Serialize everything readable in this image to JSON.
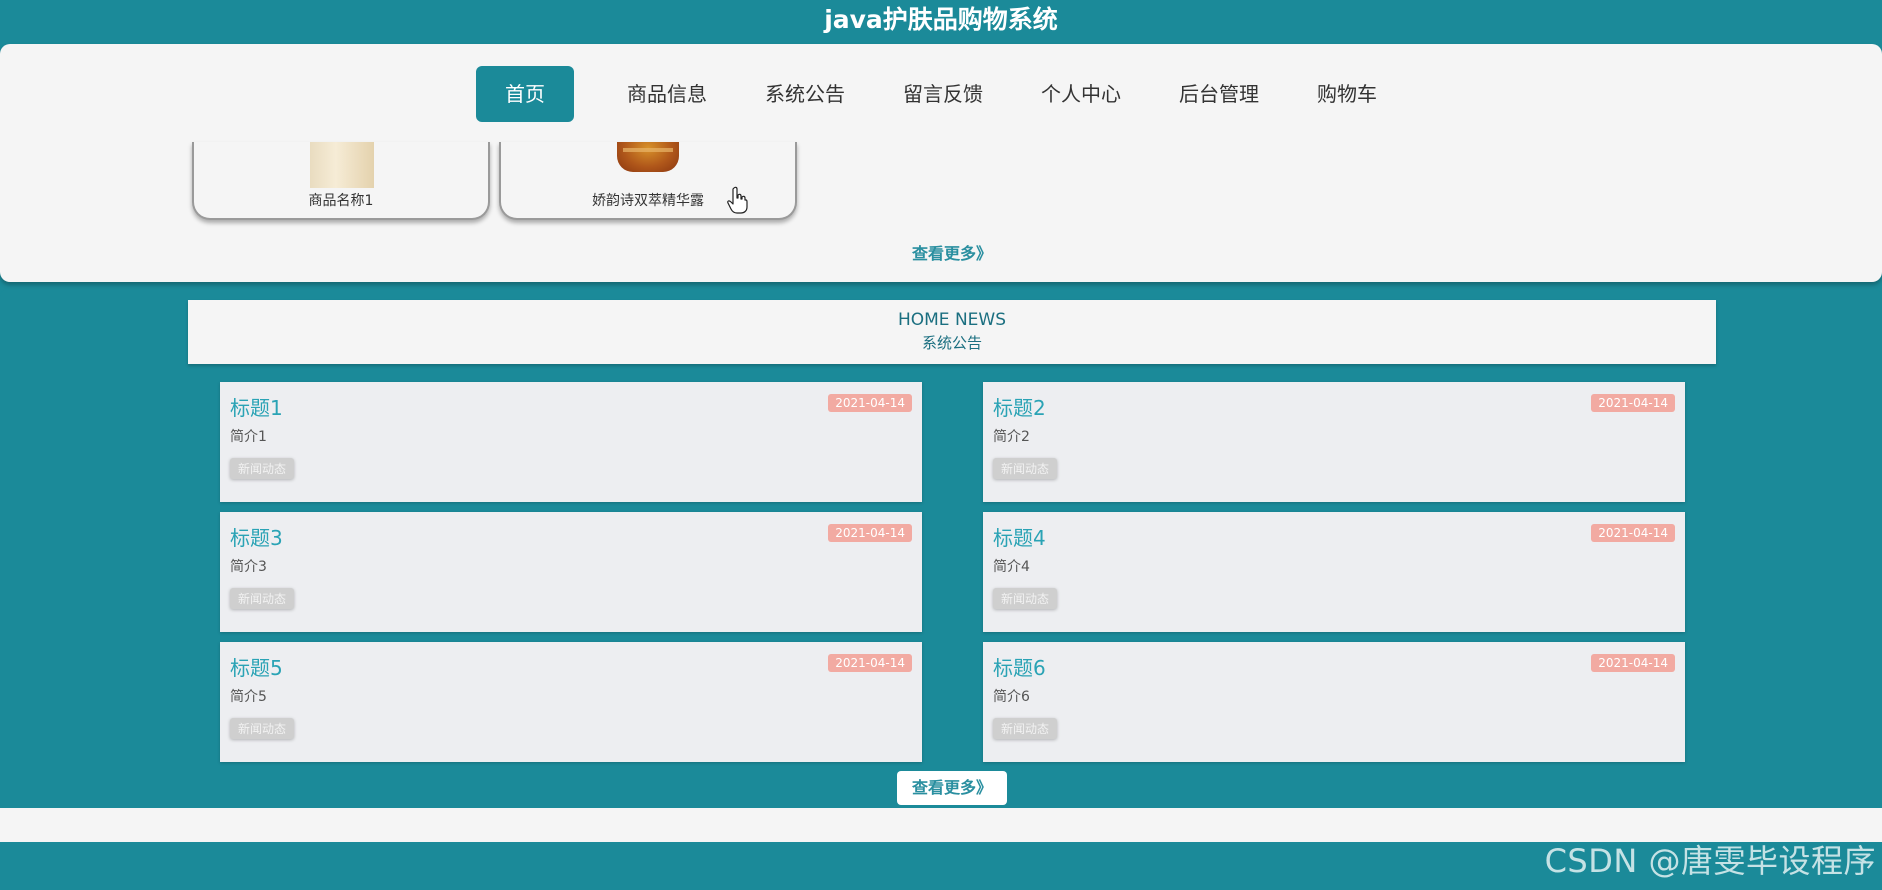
{
  "app": {
    "title": "java护肤品购物系统"
  },
  "nav": {
    "items": [
      {
        "label": "首页",
        "active": true
      },
      {
        "label": "商品信息"
      },
      {
        "label": "系统公告"
      },
      {
        "label": "留言反馈"
      },
      {
        "label": "个人中心"
      },
      {
        "label": "后台管理"
      },
      {
        "label": "购物车"
      }
    ]
  },
  "products": {
    "items": [
      {
        "name": "商品名称1"
      },
      {
        "name": "娇韵诗双萃精华露"
      }
    ],
    "more_label": "查看更多》"
  },
  "news": {
    "header_en": "HOME NEWS",
    "header_cn": "系统公告",
    "items": [
      {
        "title": "标题1",
        "summary": "简介1",
        "tag": "新闻动态",
        "date": "2021-04-14"
      },
      {
        "title": "标题2",
        "summary": "简介2",
        "tag": "新闻动态",
        "date": "2021-04-14"
      },
      {
        "title": "标题3",
        "summary": "简介3",
        "tag": "新闻动态",
        "date": "2021-04-14"
      },
      {
        "title": "标题4",
        "summary": "简介4",
        "tag": "新闻动态",
        "date": "2021-04-14"
      },
      {
        "title": "标题5",
        "summary": "简介5",
        "tag": "新闻动态",
        "date": "2021-04-14"
      },
      {
        "title": "标题6",
        "summary": "简介6",
        "tag": "新闻动态",
        "date": "2021-04-14"
      }
    ],
    "more_label": "查看更多》"
  },
  "watermark": "CSDN @唐雯毕设程序",
  "colors": {
    "primary": "#1b8a99",
    "panel": "#f5f5f5",
    "date_badge": "#f2aaa2",
    "title_text": "#2aa3b5"
  }
}
